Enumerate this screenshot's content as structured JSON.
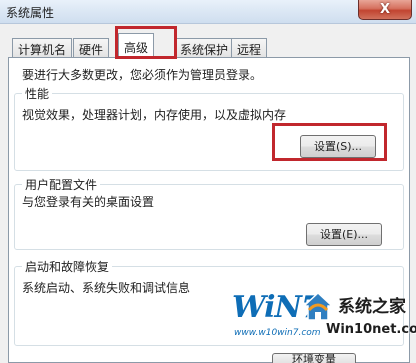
{
  "window": {
    "title": "系统属性",
    "close_label": "X"
  },
  "tabs": [
    {
      "label": "计算机名"
    },
    {
      "label": "硬件"
    },
    {
      "label": "高级"
    },
    {
      "label": "系统保护"
    },
    {
      "label": "远程"
    }
  ],
  "active_tab": "高级",
  "admin_note": "要进行大多数更改，您必须作为管理员登录。",
  "performance": {
    "label": "性能",
    "description": "视觉效果，处理器计划，内存使用，以及虚拟内存",
    "button": "设置(S)..."
  },
  "user_profiles": {
    "label": "用户配置文件",
    "description": "与您登录有关的桌面设置",
    "button": "设置(E)..."
  },
  "startup_recovery": {
    "label": "启动和故障恢复",
    "description": "系统启动、系统失败和调试信息"
  },
  "partial_button": "环境变量",
  "watermark": {
    "win7": "WiN7",
    "url_small": "www.w10win7.com",
    "brand": "系统之家",
    "url": "Win10net.com"
  }
}
